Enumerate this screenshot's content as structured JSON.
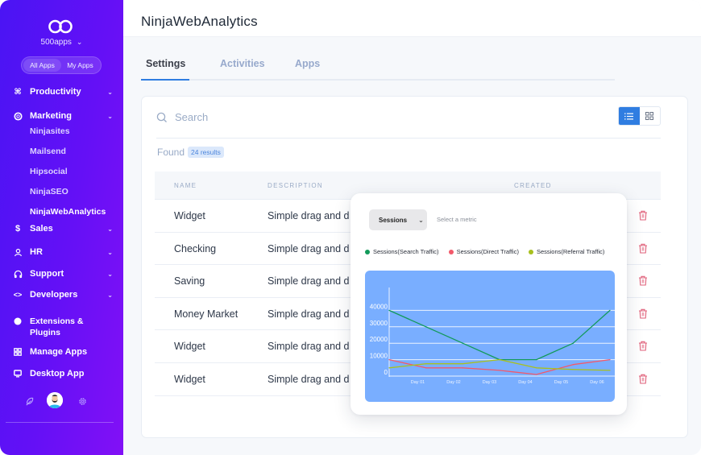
{
  "sidebar": {
    "org_name": "500apps",
    "switcher": {
      "all_apps": "All Apps",
      "my_apps": "My Apps",
      "active": "all_apps"
    },
    "items": [
      {
        "id": "productivity",
        "label": "Productivity",
        "icon": "command-icon",
        "expandable": true
      },
      {
        "id": "marketing",
        "label": "Marketing",
        "icon": "life-ring-icon",
        "expandable": true,
        "expanded": true,
        "children": [
          {
            "label": "Ninjasites",
            "active": false
          },
          {
            "label": "Mailsend",
            "active": false
          },
          {
            "label": "Hipsocial",
            "active": false
          },
          {
            "label": "NinjaSEO",
            "active": false
          },
          {
            "label": "NinjaWebAnalytics",
            "active": true
          }
        ]
      },
      {
        "id": "sales",
        "label": "Sales",
        "icon": "dollar-icon",
        "expandable": true
      },
      {
        "id": "hr",
        "label": "HR",
        "icon": "user-icon",
        "expandable": true
      },
      {
        "id": "support",
        "label": "Support",
        "icon": "headphones-icon",
        "expandable": true
      },
      {
        "id": "developers",
        "label": "Developers",
        "icon": "code-icon",
        "expandable": true
      }
    ],
    "extensions": {
      "line1": "Extensions &",
      "line2": "Plugins",
      "icon": "circle-icon"
    },
    "manage_apps": {
      "label": "Manage Apps",
      "icon": "grid-icon"
    },
    "desktop_app": {
      "label": "Desktop App",
      "icon": "monitor-icon"
    },
    "footer_icons": [
      "feather-icon",
      "avatar",
      "gear-icon"
    ]
  },
  "header": {
    "title": "NinjaWebAnalytics"
  },
  "tabs": [
    {
      "label": "Settings",
      "active": true
    },
    {
      "label": "Activities",
      "active": false
    },
    {
      "label": "Apps",
      "active": false
    }
  ],
  "search": {
    "placeholder": "Search",
    "value": ""
  },
  "view_toggle": {
    "active": "list"
  },
  "found": {
    "label": "Found",
    "count_badge": "24 results"
  },
  "table": {
    "columns": [
      "NAME",
      "DESCRIPTION",
      "CREATED"
    ],
    "rows": [
      {
        "name": "Widget",
        "description": "Simple drag and d"
      },
      {
        "name": "Checking",
        "description": "Simple drag and d"
      },
      {
        "name": "Saving",
        "description": "Simple drag and d"
      },
      {
        "name": "Money Market",
        "description": "Simple drag and d"
      },
      {
        "name": "Widget",
        "description": "Simple drag and d"
      },
      {
        "name": "Widget",
        "description": "Simple drag and d"
      }
    ]
  },
  "popup": {
    "metric_select": "Sessions",
    "metric_hint": "Select a metric"
  },
  "colors": {
    "accent": "#2f7de1",
    "delete": "#e0607a",
    "chart_bg": "#79aeff"
  },
  "chart_data": {
    "type": "line",
    "title": "",
    "xlabel": "",
    "ylabel": "",
    "categories": [
      "",
      "Day 01",
      "Day 02",
      "Day 03",
      "Day 04",
      "Day 05",
      "Day 06"
    ],
    "yticks": [
      0,
      10000,
      20000,
      30000,
      40000
    ],
    "ylim": [
      0,
      50000
    ],
    "grid": true,
    "legend_position": "top",
    "series": [
      {
        "name": "Sessions(Search Traffic)",
        "color": "#139a5a",
        "values": [
          40000,
          30000,
          20000,
          10000,
          10000,
          20000,
          40000
        ]
      },
      {
        "name": "Sessions(Direct Traffic)",
        "color": "#f2596a",
        "values": [
          10000,
          5000,
          5000,
          3500,
          1000,
          7000,
          10000
        ]
      },
      {
        "name": "Sessions(Referral Traffic)",
        "color": "#a8c01e",
        "values": [
          5000,
          7500,
          7500,
          10000,
          5000,
          4000,
          3500
        ]
      }
    ]
  }
}
